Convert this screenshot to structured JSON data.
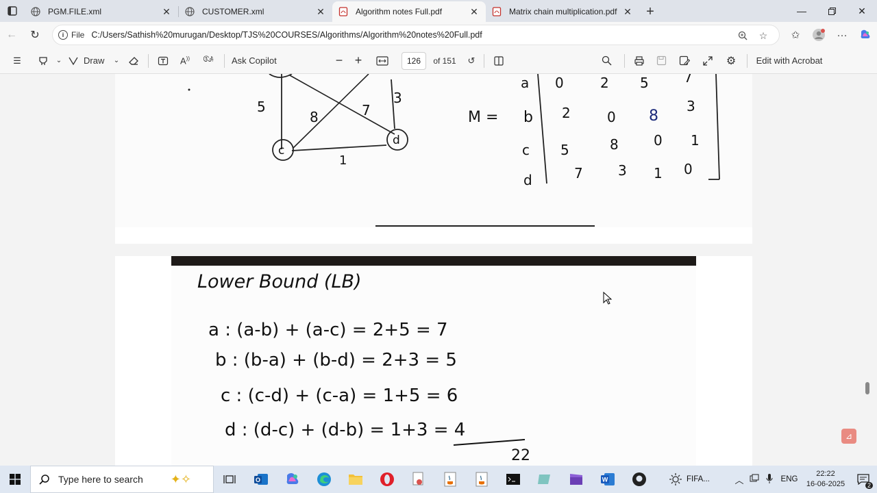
{
  "tabs": [
    {
      "title": "PGM.FILE.xml",
      "icon": "globe-icon"
    },
    {
      "title": "CUSTOMER.xml",
      "icon": "globe-icon"
    },
    {
      "title": "Algorithm notes Full.pdf",
      "icon": "pdf-icon"
    },
    {
      "title": "Matrix chain multiplication.pdf",
      "icon": "pdf-icon"
    }
  ],
  "address": {
    "scheme_label": "File",
    "url": "C:/Users/Sathish%20murugan/Desktop/TJS%20COURSES/Algorithms/Algorithm%20notes%20Full.pdf"
  },
  "pdf_toolbar": {
    "draw_label": "Draw",
    "copilot_label": "Ask Copilot",
    "page_number": "126",
    "page_total": "of 151",
    "edit_label": "Edit with Acrobat"
  },
  "page1": {
    "graph": {
      "edge_labels": [
        "5",
        "8",
        "7",
        "3",
        "1"
      ],
      "nodes": [
        "c",
        "d"
      ]
    },
    "matrix": {
      "name": "M =",
      "rows": [
        {
          "label": "a",
          "values": [
            "0",
            "2",
            "5",
            "7"
          ]
        },
        {
          "label": "b",
          "values": [
            "2",
            "0",
            "8",
            "3"
          ]
        },
        {
          "label": "c",
          "values": [
            "5",
            "8",
            "0",
            "1"
          ]
        },
        {
          "label": "d",
          "values": [
            "7",
            "3",
            "1",
            "0"
          ]
        }
      ]
    }
  },
  "page2": {
    "heading": "Lower Bound (LB)",
    "lines": [
      "a : (a-b) + (a-c) = 2+5 = 7",
      "b : (b-a) + (b-d) = 2+3 = 5",
      "c : (c-d) + (c-a) = 1+5 = 6",
      "d : (d-c) + (d-b) = 1+3 = 4"
    ],
    "total": "22"
  },
  "taskbar": {
    "search_placeholder": "Type here to search",
    "weather_text": "FIFA...",
    "language": "ENG",
    "time": "22:22",
    "date": "16-06-2025",
    "notification_count": "2"
  }
}
